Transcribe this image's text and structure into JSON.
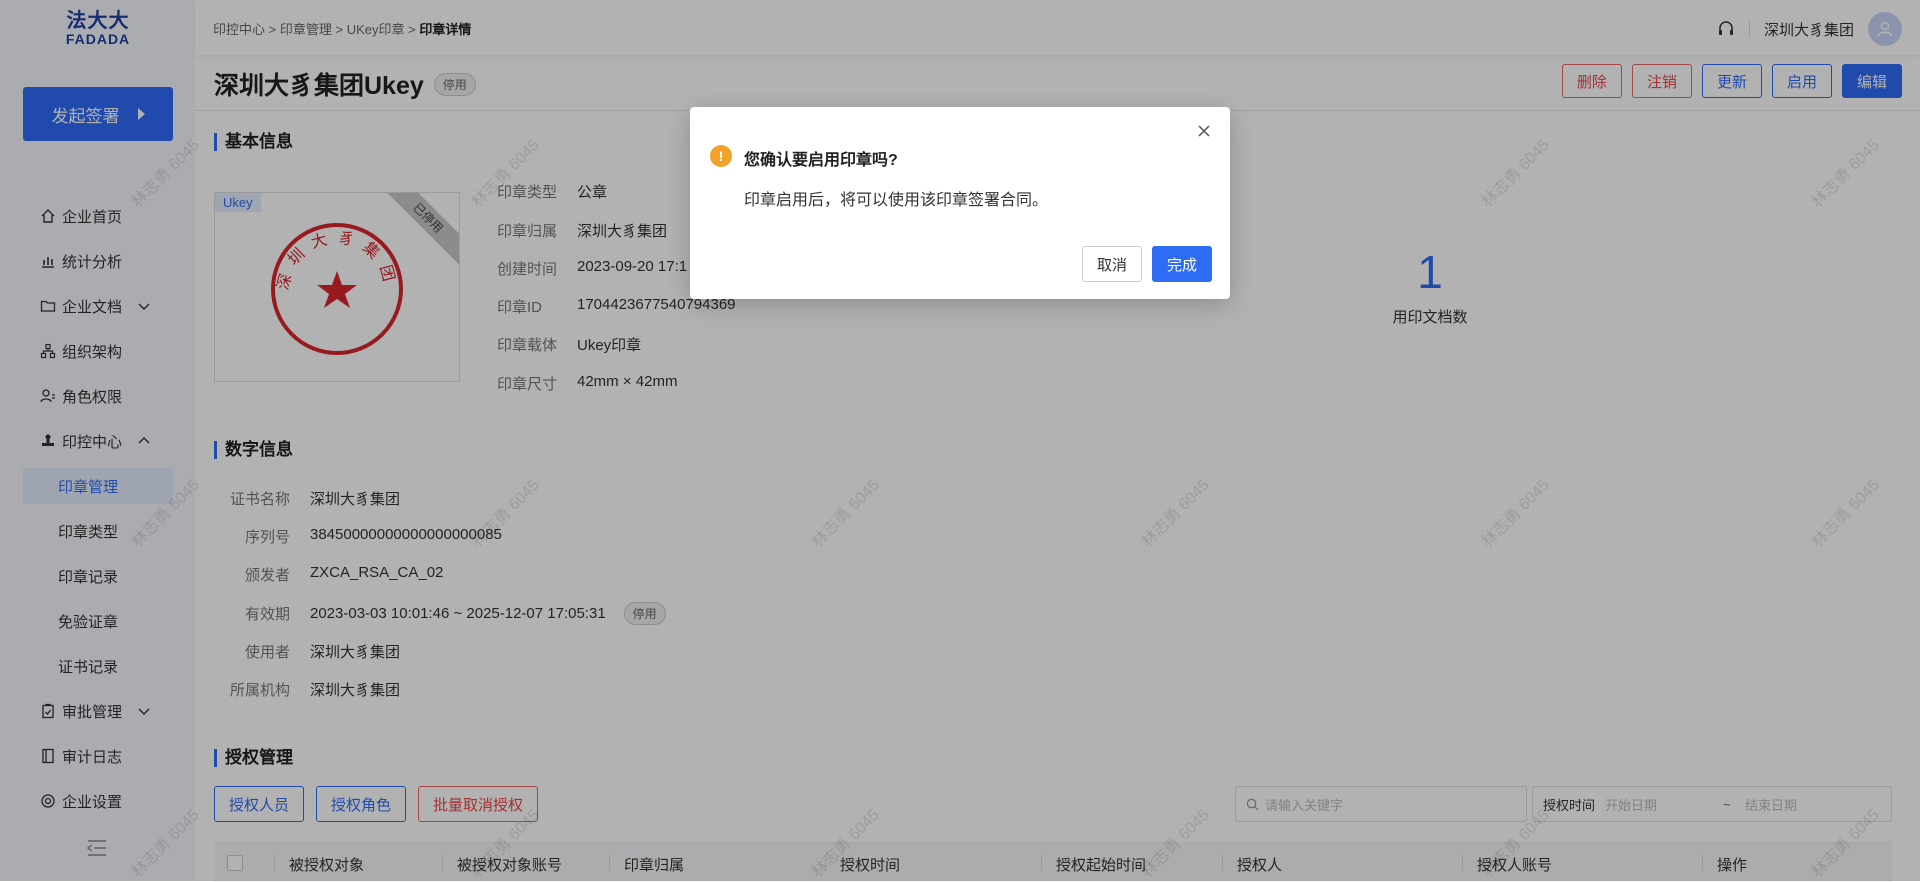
{
  "logo": {
    "cn": "法大大",
    "en": "FADADA"
  },
  "sidebar": {
    "start_button": "发起签署",
    "items": [
      {
        "label": "企业首页"
      },
      {
        "label": "统计分析"
      },
      {
        "label": "企业文档"
      },
      {
        "label": "组织架构"
      },
      {
        "label": "角色权限"
      },
      {
        "label": "印控中心"
      },
      {
        "label": "审批管理"
      },
      {
        "label": "审计日志"
      },
      {
        "label": "企业设置"
      }
    ],
    "sub_items": [
      {
        "label": "印章管理"
      },
      {
        "label": "印章类型"
      },
      {
        "label": "印章记录"
      },
      {
        "label": "免验证章"
      },
      {
        "label": "证书记录"
      }
    ]
  },
  "header": {
    "breadcrumb": [
      "印控中心",
      "印章管理",
      "UKey印章",
      "印章详情"
    ],
    "separator": " > ",
    "company": "深圳大豸集团"
  },
  "page": {
    "title": "深圳大豸集团Ukey",
    "status": "停用",
    "actions": {
      "delete": "删除",
      "cancel": "注销",
      "update": "更新",
      "enable": "启用",
      "edit": "编辑"
    }
  },
  "basic_info": {
    "title": "基本信息",
    "seal_tag": "Ukey",
    "seal_ribbon": "已停用",
    "seal_text": "深圳大豸集团",
    "fields": [
      {
        "label": "印章类型",
        "value": "公章"
      },
      {
        "label": "印章归属",
        "value": "深圳大豸集团"
      },
      {
        "label": "创建时间",
        "value": "2023-09-20 17:1"
      },
      {
        "label": "印章ID",
        "value": "1704423677540794369"
      },
      {
        "label": "印章载体",
        "value": "Ukey印章"
      },
      {
        "label": "印章尺寸",
        "value": "42mm × 42mm"
      }
    ],
    "usage_count": "1",
    "usage_label": "用印文档数"
  },
  "digital_info": {
    "title": "数字信息",
    "fields": [
      {
        "label": "证书名称",
        "value": "深圳大豸集团"
      },
      {
        "label": "序列号",
        "value": "38450000000000000000085"
      },
      {
        "label": "颁发者",
        "value": "ZXCA_RSA_CA_02"
      },
      {
        "label": "有效期",
        "value": "2023-03-03 10:01:46 ~ 2025-12-07 17:05:31"
      },
      {
        "label": "使用者",
        "value": "深圳大豸集团"
      },
      {
        "label": "所属机构",
        "value": "深圳大豸集团"
      }
    ],
    "validity_status": "停用"
  },
  "auth": {
    "title": "授权管理",
    "buttons": {
      "users": "授权人员",
      "roles": "授权角色",
      "batch_cancel": "批量取消授权"
    },
    "search_placeholder": "请输入关键字",
    "date_label": "授权时间",
    "start_date": "开始日期",
    "date_sep": "~",
    "end_date": "结束日期",
    "columns": [
      "被授权对象",
      "被授权对象账号",
      "印章归属",
      "授权时间",
      "授权起始时间",
      "授权人",
      "授权人账号",
      "操作"
    ]
  },
  "watermark": "林志勇 6045",
  "dialog": {
    "title": "您确认要启用印章吗?",
    "body": "印章启用后，将可以使用该印章签署合同。",
    "cancel": "取消",
    "confirm": "完成"
  },
  "colors": {
    "primary": "#2e6cf6",
    "warning": "#f2a12b",
    "danger": "#e44444",
    "seal_red": "#d9262e"
  }
}
